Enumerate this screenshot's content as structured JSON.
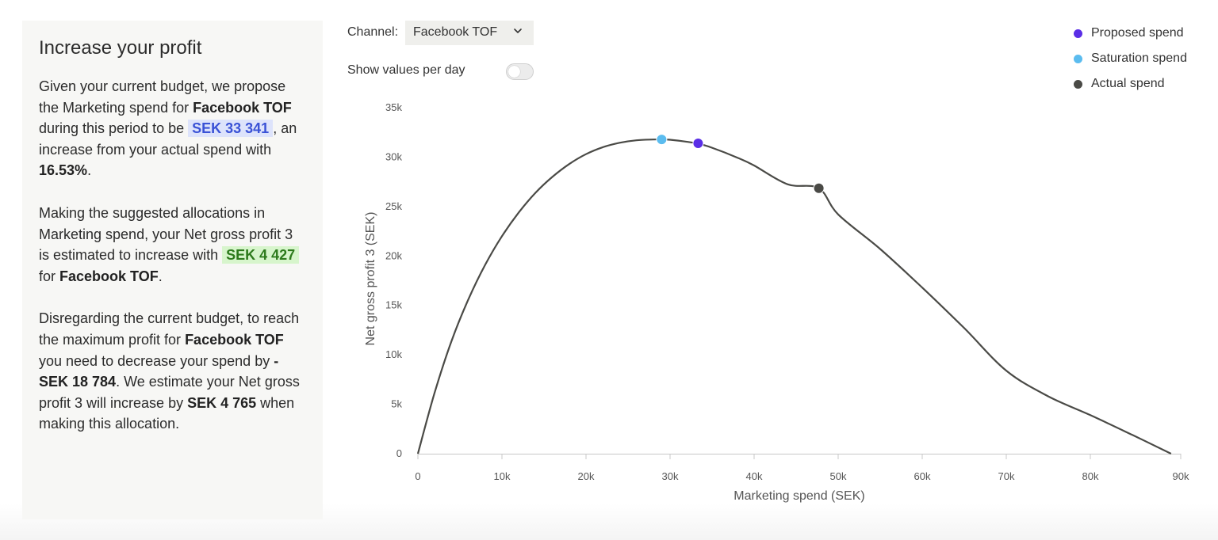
{
  "panel": {
    "title": "Increase your profit",
    "p1": {
      "t1": "Given your current budget, we propose the Marketing spend for ",
      "channel": "Facebook TOF",
      "t2": " during this period to be ",
      "amount": "SEK 33 341",
      "t3": ", an increase from your actual spend with ",
      "pct": "16.53%",
      "t4": "."
    },
    "p2": {
      "t1": "Making the suggested allocations in Marketing spend, your Net gross profit 3 is estimated to increase with ",
      "amount": "SEK 4 427",
      "t2": " for ",
      "channel": "Facebook TOF",
      "t3": "."
    },
    "p3": {
      "t1": "Disregarding the current budget, to reach the maximum profit for ",
      "channel": "Facebook TOF",
      "t2": " you need to decrease your spend by ",
      "amount1": "-SEK 18 784",
      "t3": ". We estimate your Net gross profit 3 will increase by ",
      "amount2": "SEK 4 765",
      "t4": " when making this allocation."
    }
  },
  "controls": {
    "channel_label": "Channel:",
    "channel_value": "Facebook TOF",
    "toggle_label": "Show values per day",
    "toggle_on": false
  },
  "legend": [
    {
      "label": "Proposed spend",
      "color": "#5a2ee6"
    },
    {
      "label": "Saturation spend",
      "color": "#5bbcef"
    },
    {
      "label": "Actual spend",
      "color": "#4a4a46"
    }
  ],
  "chart_data": {
    "type": "line",
    "xlabel": "Marketing spend (SEK)",
    "ylabel": "Net gross profit 3 (SEK)",
    "xlim": [
      0,
      90000
    ],
    "ylim": [
      0,
      35000
    ],
    "x_ticks": [
      0,
      10000,
      20000,
      30000,
      40000,
      50000,
      60000,
      70000,
      80000,
      90000
    ],
    "x_tick_labels": [
      "0",
      "10k",
      "20k",
      "30k",
      "40k",
      "50k",
      "60k",
      "70k",
      "80k",
      "90k"
    ],
    "y_ticks": [
      0,
      5000,
      10000,
      15000,
      20000,
      25000,
      30000,
      35000
    ],
    "y_tick_labels": [
      "0",
      "5k",
      "10k",
      "15k",
      "20k",
      "25k",
      "30k",
      "35k"
    ],
    "curve_color": "#4a4a46",
    "series": [
      {
        "x": [
          0,
          2000,
          4000,
          6000,
          8000,
          10000,
          12000,
          14000,
          16000,
          18000,
          20000,
          22000,
          24000,
          26000,
          28000,
          29000,
          30000,
          32000,
          33341,
          35000,
          38000,
          40000,
          44000,
          47700,
          50000,
          55000,
          60000,
          65000,
          70000,
          75000,
          80000,
          85000,
          89600
        ],
        "y": [
          0,
          6200,
          11400,
          15600,
          19100,
          22000,
          24400,
          26400,
          28000,
          29300,
          30300,
          31000,
          31450,
          31700,
          31780,
          31790,
          31760,
          31550,
          31360,
          30950,
          29950,
          29150,
          27250,
          26850,
          24200,
          20700,
          16800,
          12700,
          8400,
          5800,
          3900,
          1900,
          0
        ]
      }
    ],
    "markers": [
      {
        "name": "Saturation spend",
        "x": 29000,
        "y": 31790,
        "color": "#5bbcef"
      },
      {
        "name": "Proposed spend",
        "x": 33341,
        "y": 31400,
        "color": "#5a2ee6"
      },
      {
        "name": "Actual spend",
        "x": 47700,
        "y": 26850,
        "color": "#4a4a46"
      }
    ]
  }
}
